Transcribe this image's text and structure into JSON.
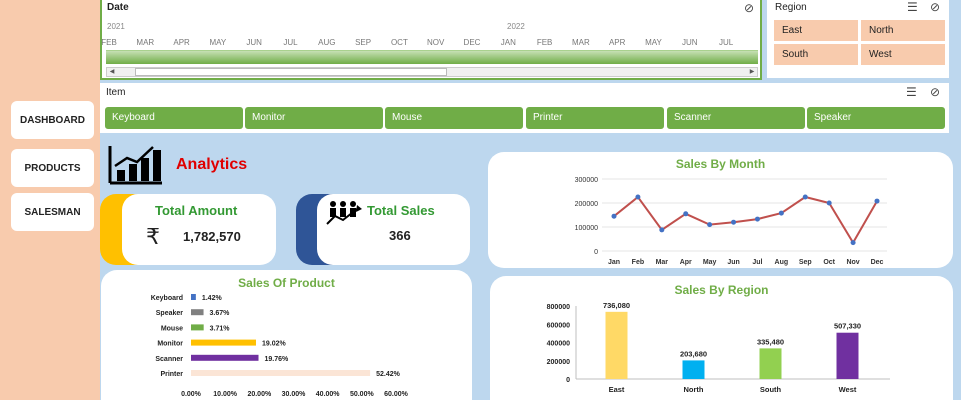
{
  "nav": {
    "dashboard": "DASHBOARD",
    "products": "PRODUCTS",
    "salesman": "SALESMAN"
  },
  "date_slicer": {
    "title": "Date",
    "years": [
      "2021",
      "2022"
    ],
    "months": [
      "FEB",
      "MAR",
      "APR",
      "MAY",
      "JUN",
      "JUL",
      "AUG",
      "SEP",
      "OCT",
      "NOV",
      "DEC",
      "JAN",
      "FEB",
      "MAR",
      "APR",
      "MAY",
      "JUN",
      "JUL"
    ]
  },
  "region_slicer": {
    "title": "Region",
    "items": [
      "East",
      "North",
      "South",
      "West"
    ]
  },
  "item_slicer": {
    "title": "Item",
    "items": [
      "Keyboard",
      "Monitor",
      "Mouse",
      "Printer",
      "Scanner",
      "Speaker"
    ]
  },
  "analytics": {
    "title": "Analytics"
  },
  "kpis": {
    "total_amount": {
      "title": "Total Amount",
      "currency": "₹",
      "value": "1,782,570",
      "accent": "#ffc000"
    },
    "total_sales": {
      "title": "Total Sales",
      "value": "366",
      "accent": "#2f5597"
    }
  },
  "colors": {
    "green": "#70ad47",
    "peach": "#f8cbad",
    "bg": "#bdd7ee",
    "red": "#e00000"
  },
  "chart_data": [
    {
      "id": "sales_by_month",
      "type": "line",
      "title": "Sales By Month",
      "categories": [
        "Jan",
        "Feb",
        "Mar",
        "Apr",
        "May",
        "Jun",
        "Jul",
        "Aug",
        "Sep",
        "Oct",
        "Nov",
        "Dec"
      ],
      "series": [
        {
          "values": [
            145000,
            225000,
            88000,
            155000,
            110000,
            120000,
            133000,
            158000,
            225000,
            200000,
            35000,
            208000
          ]
        }
      ],
      "ylim": [
        0,
        300000
      ],
      "yticks": [
        "0",
        "100000",
        "200000",
        "300000"
      ],
      "ytick_values": [
        0,
        100000,
        200000,
        300000
      ],
      "line_color": "#c0504d",
      "marker_color": "#4472c4"
    },
    {
      "id": "sales_of_product",
      "type": "bar",
      "orientation": "horizontal",
      "title": "Sales Of Product",
      "categories": [
        "Keyboard",
        "Speaker",
        "Mouse",
        "Monitor",
        "Scanner",
        "Printer"
      ],
      "values": [
        1.42,
        3.67,
        3.71,
        19.02,
        19.76,
        52.42
      ],
      "labels": [
        "1.42%",
        "3.67%",
        "3.71%",
        "19.02%",
        "19.76%",
        "52.42%"
      ],
      "bar_colors": [
        "#4472c4",
        "#808080",
        "#70ad47",
        "#ffc000",
        "#7030a0",
        "#fbe5d6"
      ],
      "xlim": [
        0,
        60
      ],
      "xticks": [
        "0.00%",
        "10.00%",
        "20.00%",
        "30.00%",
        "40.00%",
        "50.00%",
        "60.00%"
      ]
    },
    {
      "id": "sales_by_region",
      "type": "bar",
      "title": "Sales By Region",
      "categories": [
        "East",
        "North",
        "South",
        "West"
      ],
      "values": [
        736080,
        203680,
        335480,
        507330
      ],
      "labels": [
        "736,080",
        "203,680",
        "335,480",
        "507,330"
      ],
      "bar_colors": [
        "#ffd966",
        "#00b0f0",
        "#92d050",
        "#7030a0"
      ],
      "ylim": [
        0,
        800000
      ],
      "yticks": [
        "0",
        "200000",
        "400000",
        "600000",
        "800000"
      ],
      "ytick_values": [
        0,
        200000,
        400000,
        600000,
        800000
      ]
    }
  ]
}
